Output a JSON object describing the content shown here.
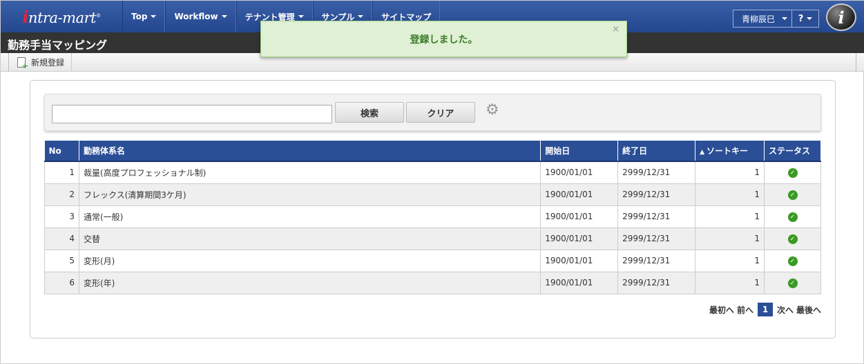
{
  "header": {
    "logo": "intra-mart",
    "nav": [
      "Top",
      "Workflow",
      "テナント管理",
      "サンプル",
      "サイトマップ"
    ],
    "nav_has_caret": [
      true,
      true,
      true,
      true,
      false
    ],
    "user": "青柳辰巳",
    "help": "?"
  },
  "page": {
    "title": "勤務手当マッピング"
  },
  "toolbar": {
    "new_label": "新規登録"
  },
  "toast": {
    "message": "登録しました。",
    "close": "×"
  },
  "search": {
    "value": "",
    "search_label": "検索",
    "clear_label": "クリア"
  },
  "table": {
    "headers": [
      "No",
      "勤務体系名",
      "開始日",
      "終了日",
      "ソートキー",
      "ステータス"
    ],
    "rows": [
      {
        "no": "1",
        "name": "裁量(高度プロフェッショナル制)",
        "start": "1900/01/01",
        "end": "2999/12/31",
        "sort": "1",
        "status": "active"
      },
      {
        "no": "2",
        "name": "フレックス(清算期間3ケ月)",
        "start": "1900/01/01",
        "end": "2999/12/31",
        "sort": "1",
        "status": "active"
      },
      {
        "no": "3",
        "name": "通常(一般)",
        "start": "1900/01/01",
        "end": "2999/12/31",
        "sort": "1",
        "status": "active"
      },
      {
        "no": "4",
        "name": "交替",
        "start": "1900/01/01",
        "end": "2999/12/31",
        "sort": "1",
        "status": "active"
      },
      {
        "no": "5",
        "name": "変形(月)",
        "start": "1900/01/01",
        "end": "2999/12/31",
        "sort": "1",
        "status": "active"
      },
      {
        "no": "6",
        "name": "変形(年)",
        "start": "1900/01/01",
        "end": "2999/12/31",
        "sort": "1",
        "status": "active"
      }
    ]
  },
  "pager": {
    "first": "最初へ",
    "prev": "前へ",
    "current": "1",
    "next": "次へ",
    "last": "最後へ"
  },
  "colors": {
    "nav_bg": "#24478e",
    "title_bar": "#333333",
    "toast_bg": "#dff0d4",
    "status_ok": "#3a9a24"
  }
}
